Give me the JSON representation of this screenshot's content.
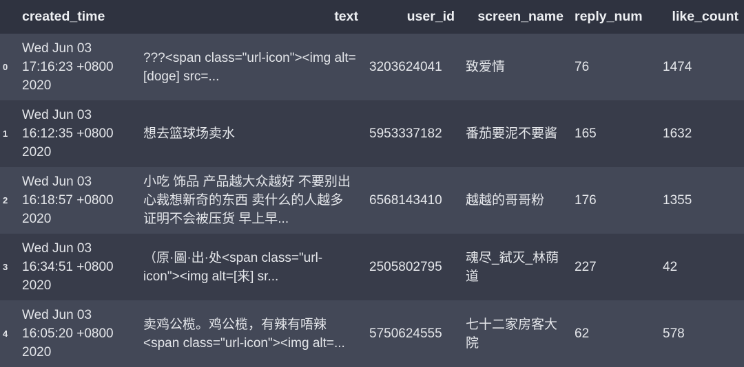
{
  "columns": {
    "index": "",
    "created_time": "created_time",
    "text": "text",
    "user_id": "user_id",
    "screen_name": "screen_name",
    "reply_num": "reply_num",
    "like_count": "like_count"
  },
  "rows": [
    {
      "index": "0",
      "created_time": "Wed Jun 03 17:16:23 +0800 2020",
      "text": "???<span class=\"url-icon\"><img alt=[doge] src=...",
      "user_id": "3203624041",
      "screen_name": "致爱情",
      "reply_num": "76",
      "like_count": "1474"
    },
    {
      "index": "1",
      "created_time": "Wed Jun 03 16:12:35 +0800 2020",
      "text": "想去篮球场卖水",
      "user_id": "5953337182",
      "screen_name": "番茄要泥不要酱",
      "reply_num": "165",
      "like_count": "1632"
    },
    {
      "index": "2",
      "created_time": "Wed Jun 03 16:18:57 +0800 2020",
      "text": "小吃 饰品 产品越大众越好 不要别出心裁想新奇的东西 卖什么的人越多 证明不会被压货 早上早...",
      "user_id": "6568143410",
      "screen_name": "越越的哥哥粉",
      "reply_num": "176",
      "like_count": "1355"
    },
    {
      "index": "3",
      "created_time": "Wed Jun 03 16:34:51 +0800 2020",
      "text": "（原·圖·出·处<span class=\"url-icon\"><img alt=[来] sr...",
      "user_id": "2505802795",
      "screen_name": "魂尽_弑灭_林荫道",
      "reply_num": "227",
      "like_count": "42"
    },
    {
      "index": "4",
      "created_time": "Wed Jun 03 16:05:20 +0800 2020",
      "text": "卖鸡公榄。鸡公榄，有辣有唔辣<span class=\"url-icon\"><img alt=...",
      "user_id": "5750624555",
      "screen_name": "七十二家房客大院",
      "reply_num": "62",
      "like_count": "578"
    }
  ]
}
